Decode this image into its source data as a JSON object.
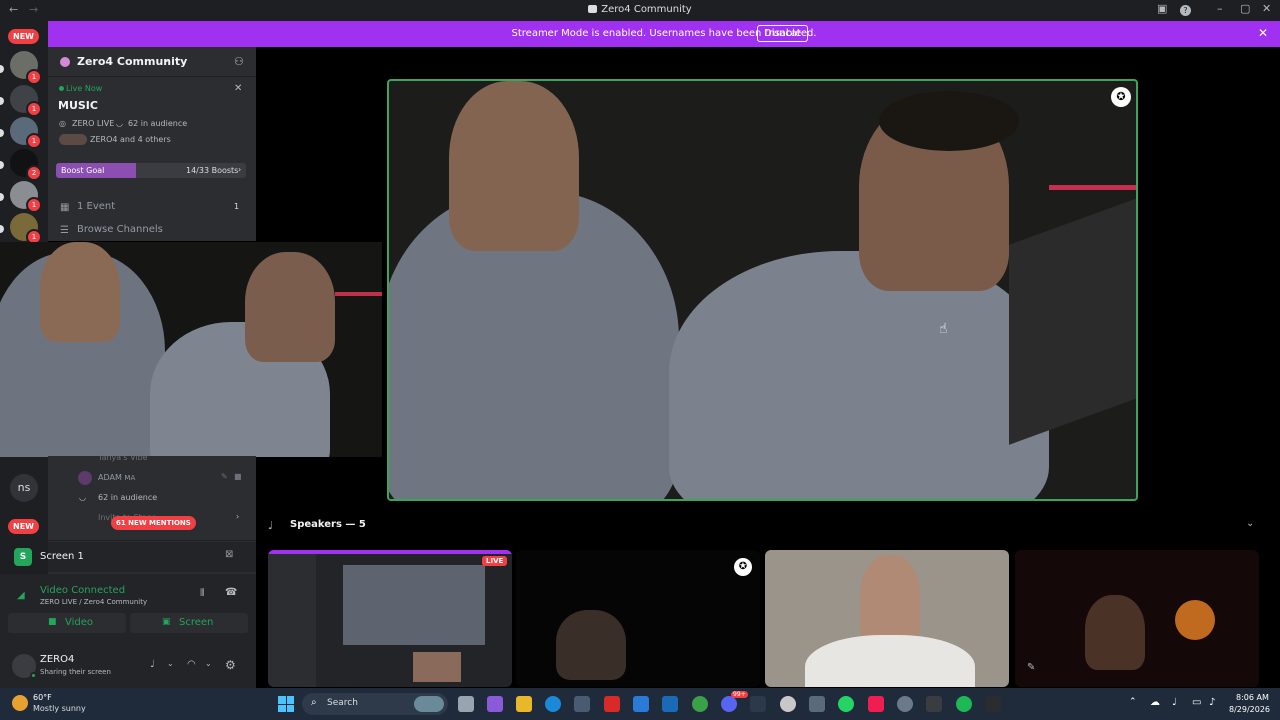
{
  "window": {
    "title": "Zero4 Community",
    "back_icon": "arrow-left-icon",
    "forward_icon": "arrow-right-icon"
  },
  "banner": {
    "text": "Streamer Mode is enabled. Usernames have been truncated.",
    "disable_label": "Disable",
    "color": "#a031f0"
  },
  "rail": {
    "new_label": "NEW",
    "new_bottom_label": "NEW",
    "ns_label": "ns",
    "badges": [
      "1",
      "1",
      "1",
      "2",
      "1",
      "1"
    ]
  },
  "server": {
    "name": "Zero4 Community",
    "live_now": "Live Now",
    "event_title": "MUSIC",
    "host": "ZERO LIVE",
    "audience": "62 in audience",
    "others": "ZERO4 and 4 others",
    "boost_label": "Boost Goal",
    "boost_count": "14/33 Boosts",
    "boost_progress": 0.42,
    "events_label": "1 Event",
    "events_count": "1",
    "browse_label": "Browse Channels"
  },
  "stage_list": {
    "partial_name": "Tanya's Vibe",
    "member_name": "ADAM",
    "member_tag": "MA",
    "audience": "62 in audience",
    "invite_label": "Invite to Stage",
    "mentions_label": "61 NEW MENTIONS"
  },
  "screen_share": {
    "icon_letter": "S",
    "label": "Screen 1"
  },
  "connection": {
    "status": "Video Connected",
    "location": "ZERO LIVE / Zero4 Community",
    "video_label": "Video",
    "screen_label": "Screen",
    "status_color": "#23a55a"
  },
  "user": {
    "name": "ZERO4",
    "status": "Sharing their screen"
  },
  "speakers": {
    "header": "Speakers — 5",
    "live_badge": "LIVE"
  },
  "taskbar": {
    "weather_temp": "60°F",
    "weather_desc": "Mostly sunny",
    "search_label": "Search",
    "time": "8:06 AM",
    "date": "8/29/2026",
    "app_badge": "99+"
  }
}
